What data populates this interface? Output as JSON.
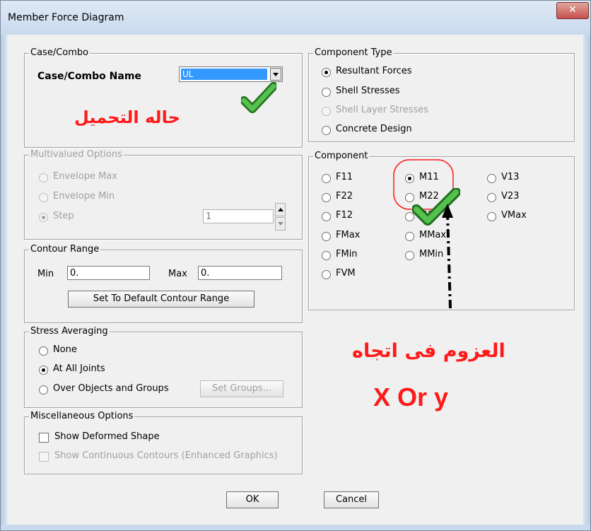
{
  "window": {
    "title": "Member Force Diagram",
    "close_glyph": "✕"
  },
  "case_combo": {
    "legend": "Case/Combo",
    "name_label": "Case/Combo Name",
    "selected": "UL",
    "annotation": "حاله التحميل"
  },
  "multivalued": {
    "legend": "Multivalued Options",
    "options": [
      "Envelope Max",
      "Envelope Min",
      "Step"
    ],
    "step_value": "1"
  },
  "contour": {
    "legend": "Contour Range",
    "min_label": "Min",
    "min_value": "0.",
    "max_label": "Max",
    "max_value": "0.",
    "default_button": "Set To Default Contour Range"
  },
  "stress": {
    "legend": "Stress Averaging",
    "options": [
      "None",
      "At All Joints",
      "Over Objects and Groups"
    ],
    "set_groups_button": "Set Groups..."
  },
  "misc": {
    "legend": "Miscellaneous Options",
    "show_deformed": "Show Deformed Shape",
    "show_continuous": "Show Continuous Contours  (Enhanced Graphics)"
  },
  "component_type": {
    "legend": "Component Type",
    "options": [
      "Resultant Forces",
      "Shell Stresses",
      "Shell Layer Stresses",
      "Concrete Design"
    ]
  },
  "component": {
    "legend": "Component",
    "col1": [
      "F11",
      "F22",
      "F12",
      "FMax",
      "FMin",
      "FVM"
    ],
    "col2": [
      "M11",
      "M22",
      "M12",
      "MMax",
      "MMin"
    ],
    "col3": [
      "V13",
      "V23",
      "VMax"
    ],
    "selected": "M11"
  },
  "annotations": {
    "moments_text": "العزوم فى اتجاه",
    "axes_text": "X  Or y"
  },
  "buttons": {
    "ok": "OK",
    "cancel": "Cancel"
  },
  "colors": {
    "annotation_red": "#ff1a1a",
    "check_green": "#3fa33a",
    "title_bar": "#c9daee",
    "selection_blue": "#3399ff"
  }
}
